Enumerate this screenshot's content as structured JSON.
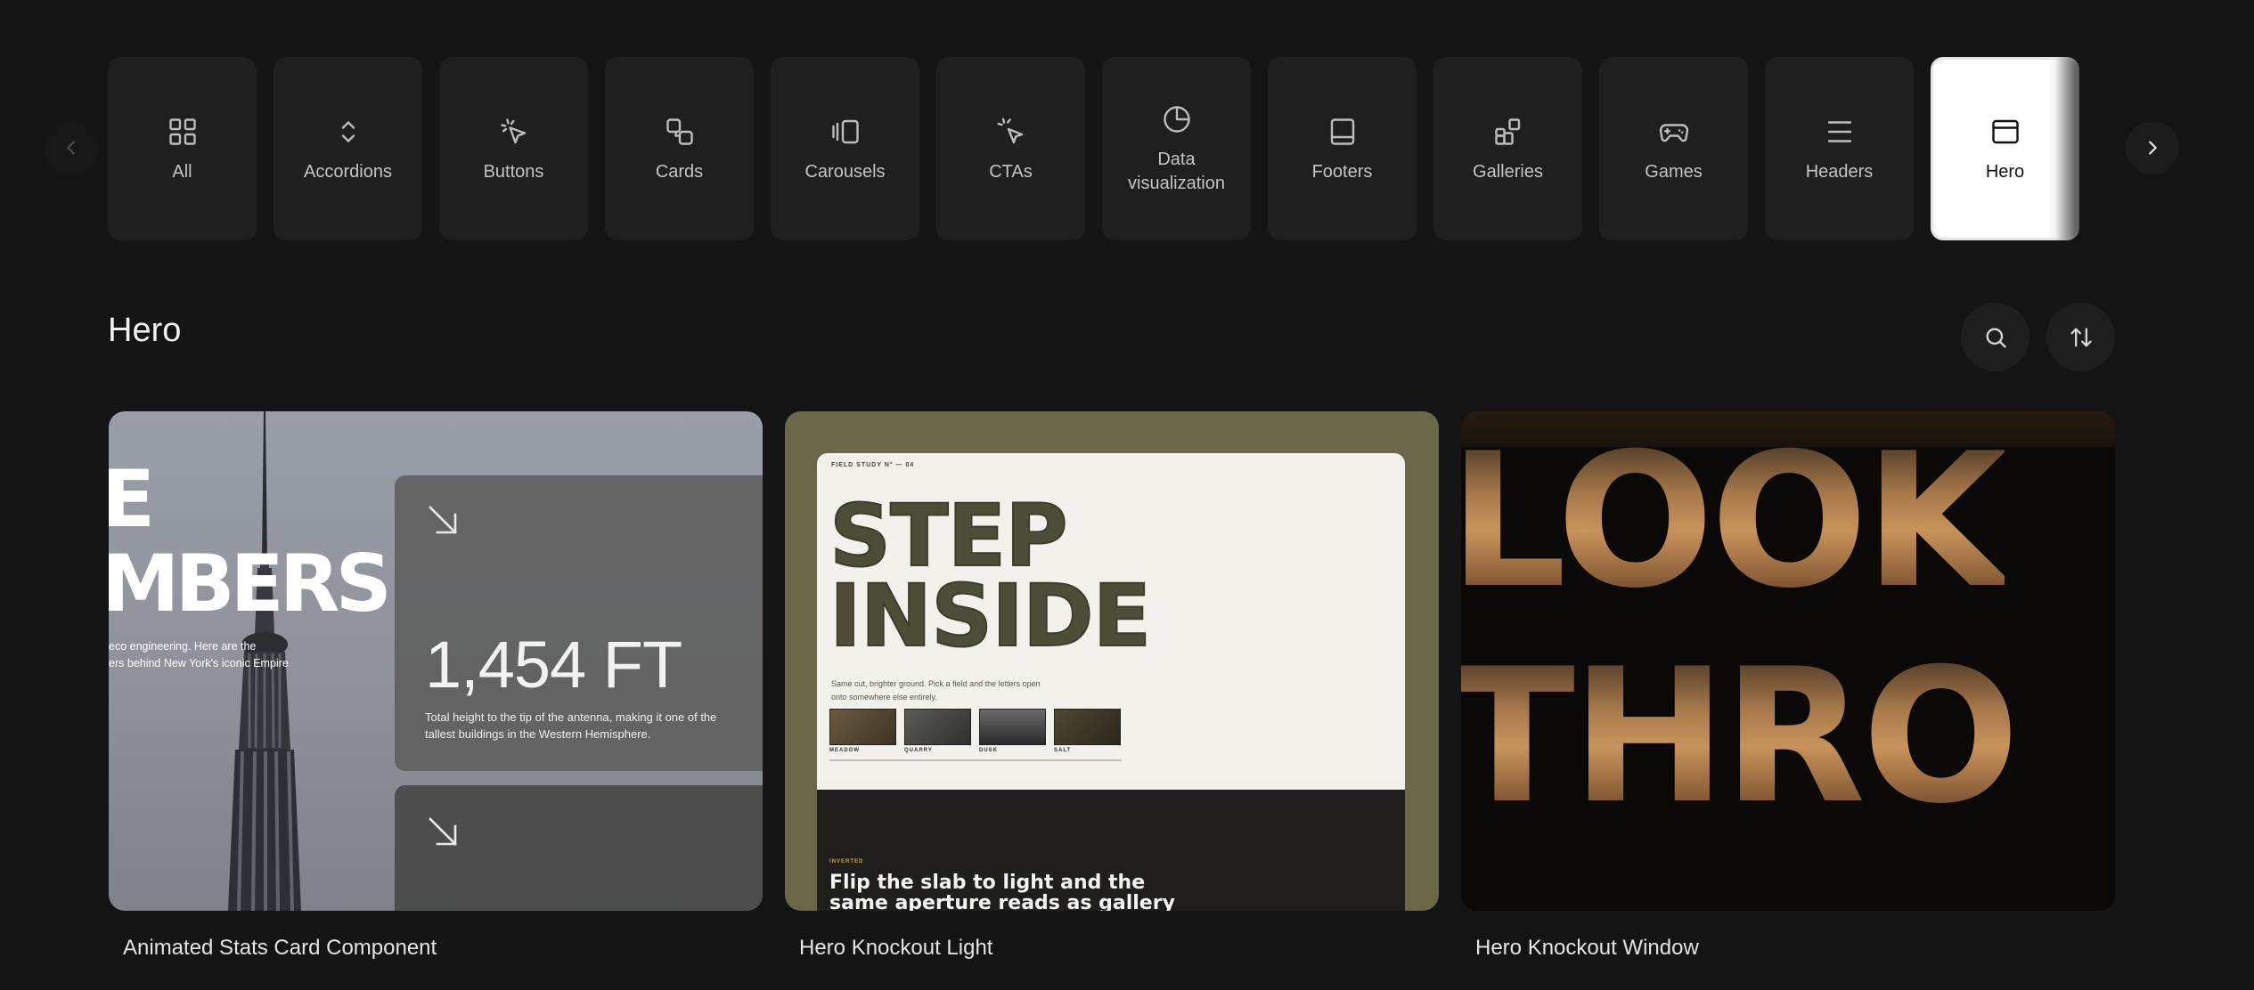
{
  "categories": {
    "items": [
      {
        "label": "All",
        "icon": "grid-icon",
        "active": false
      },
      {
        "label": "Accordions",
        "icon": "chevrons-up-down-icon",
        "active": false
      },
      {
        "label": "Buttons",
        "icon": "pointer-click-icon",
        "active": false
      },
      {
        "label": "Cards",
        "icon": "cards-icon",
        "active": false
      },
      {
        "label": "Carousels",
        "icon": "carousel-icon",
        "active": false
      },
      {
        "label": "CTAs",
        "icon": "cursor-click-icon",
        "active": false
      },
      {
        "label": "Data\nvisualization",
        "icon": "pie-chart-icon",
        "active": false
      },
      {
        "label": "Footers",
        "icon": "footer-layout-icon",
        "active": false
      },
      {
        "label": "Galleries",
        "icon": "gallery-icon",
        "active": false
      },
      {
        "label": "Games",
        "icon": "gamepad-icon",
        "active": false
      },
      {
        "label": "Headers",
        "icon": "menu-lines-icon",
        "active": false
      },
      {
        "label": "Hero",
        "icon": "hero-layout-icon",
        "active": true
      }
    ]
  },
  "section": {
    "title": "Hero"
  },
  "toolbar": {
    "search_icon": "search-icon",
    "sort_icon": "sort-arrows-icon"
  },
  "cards": [
    {
      "title": "Animated Stats Card Component",
      "preview": {
        "headline_line1": "E",
        "headline_line2": "MBERS",
        "intro": "eco engineering. Here are the\ners behind New York's iconic Empire",
        "stat_value": "1,454 FT",
        "stat_desc": "Total height to the tip of the antenna, making it one of the tallest buildings in the Western Hemisphere."
      }
    },
    {
      "title": "Hero Knockout Light",
      "preview": {
        "eyebrow": "FIELD STUDY N° — 04",
        "headline": "STEP\nINSIDE",
        "intro": "Same cut, brighter ground. Pick a field and the letters open\nonto somewhere else entirely.",
        "swatches": [
          "MEADOW",
          "QUARRY",
          "DUSK",
          "SALT"
        ],
        "kicker": "INVERTED",
        "subhead": "Flip the slab to light and the same aperture reads as gallery"
      }
    },
    {
      "title": "Hero Knockout Window",
      "preview": {
        "line1": "LOOK",
        "line2": "THRO"
      }
    }
  ],
  "colors": {
    "background": "#141414",
    "tile": "#1f1f1f",
    "active_tile": "#ffffff",
    "card2_bg": "#6b6749",
    "sand": "#c8935b"
  }
}
